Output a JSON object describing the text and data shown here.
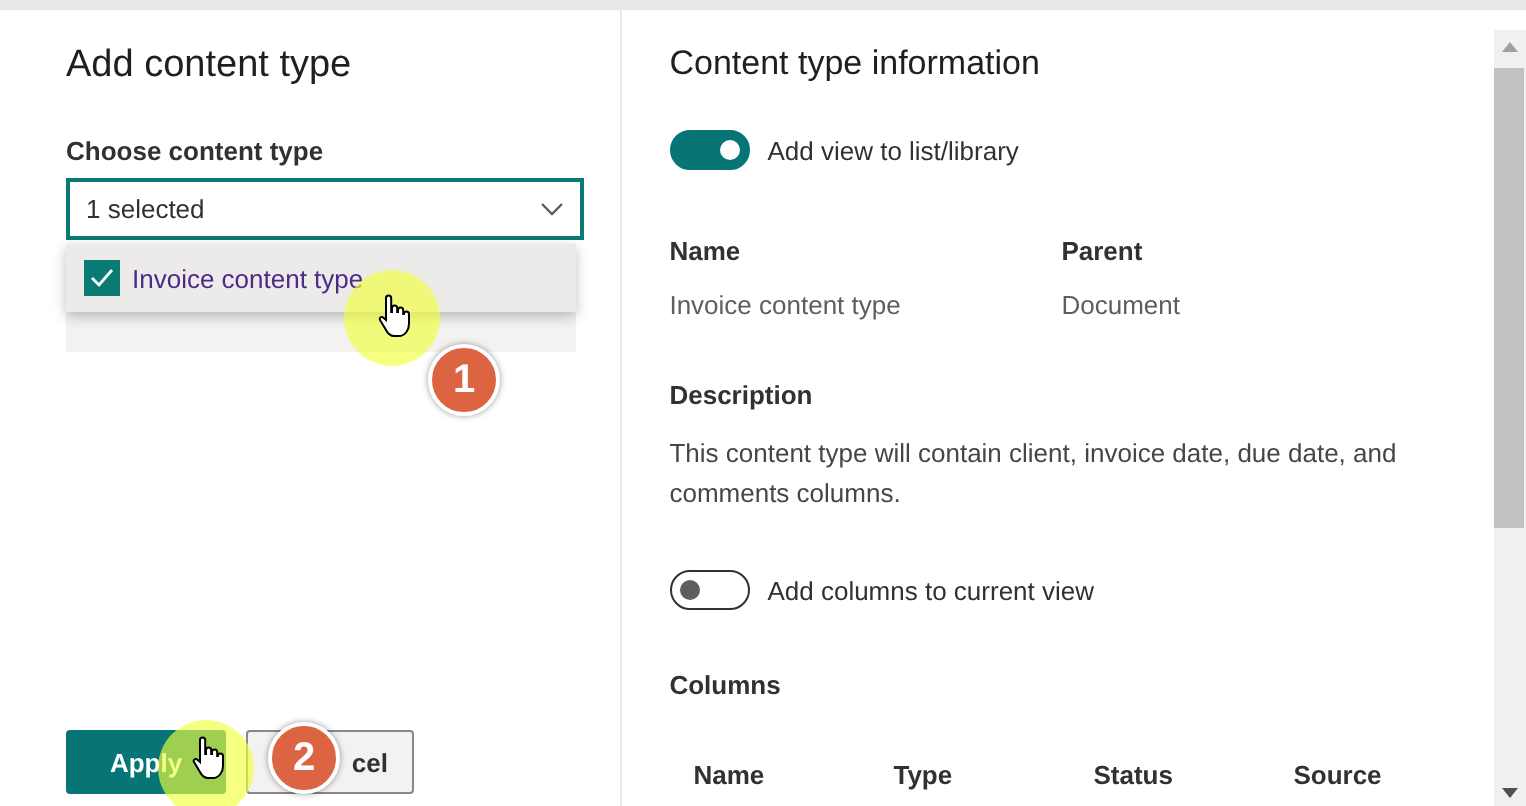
{
  "left_panel": {
    "title": "Add content type",
    "field_label": "Choose content type",
    "dropdown": {
      "value": "1 selected",
      "expanded": true
    },
    "options": [
      {
        "label": "Invoice content type",
        "checked": true
      }
    ],
    "buttons": [
      {
        "label": "Apply",
        "kind": "primary"
      },
      {
        "label": "cel",
        "kind": "secondary"
      }
    ]
  },
  "right_panel": {
    "title": "Content type information",
    "view_toggle": {
      "label": "Add view to list/library",
      "on": true
    },
    "fields": [
      {
        "label": "Name",
        "value": "Invoice content type"
      },
      {
        "label": "Parent",
        "value": "Document"
      }
    ],
    "description": {
      "label": "Description",
      "text": "This content type will contain client, invoice date, due date, and comments columns."
    },
    "columns_toggle": {
      "label": "Add columns to current view",
      "on": false
    },
    "columns": {
      "label": "Columns",
      "headers": [
        "Name",
        "Type",
        "Status",
        "Source"
      ]
    }
  },
  "steps": [
    "1",
    "2"
  ]
}
